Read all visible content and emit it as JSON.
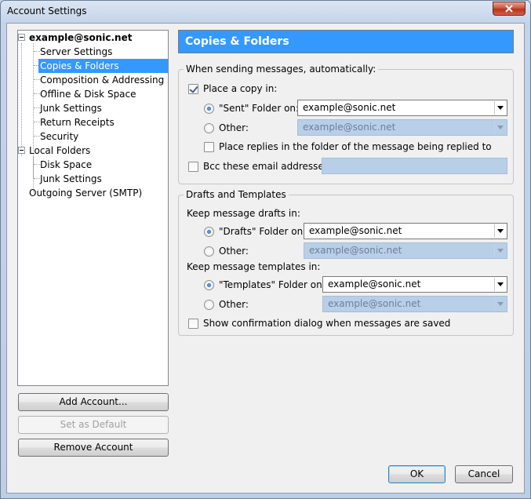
{
  "window": {
    "title": "Account Settings"
  },
  "tree": {
    "items": [
      {
        "label": "example@sonic.net",
        "level": 0,
        "bold": true,
        "expander": true
      },
      {
        "label": "Server Settings",
        "level": 1
      },
      {
        "label": "Copies & Folders",
        "level": 1,
        "selected": true
      },
      {
        "label": "Composition & Addressing",
        "level": 1
      },
      {
        "label": "Offline & Disk Space",
        "level": 1
      },
      {
        "label": "Junk Settings",
        "level": 1
      },
      {
        "label": "Return Receipts",
        "level": 1
      },
      {
        "label": "Security",
        "level": 1
      },
      {
        "label": "Local Folders",
        "level": 0,
        "expander": true
      },
      {
        "label": "Disk Space",
        "level": 1
      },
      {
        "label": "Junk Settings",
        "level": 1
      },
      {
        "label": "Outgoing Server (SMTP)",
        "level": 0
      }
    ]
  },
  "buttons": {
    "add_account": "Add Account...",
    "set_default": "Set as Default",
    "remove_account": "Remove Account",
    "ok": "OK",
    "cancel": "Cancel"
  },
  "panel": {
    "title": "Copies & Folders",
    "sending": {
      "legend": "When sending messages, automatically:",
      "place_copy": {
        "label": "Place a copy in:",
        "checked": true
      },
      "sent_folder": {
        "label": "\"Sent\" Folder on:",
        "value": "example@sonic.net",
        "selected": true
      },
      "other": {
        "label": "Other:",
        "value": "example@sonic.net",
        "selected": false
      },
      "place_replies": {
        "label": "Place replies in the folder of the message being replied to",
        "checked": false
      },
      "bcc": {
        "label": "Bcc these email addresses:",
        "checked": false,
        "value": ""
      }
    },
    "drafts": {
      "legend": "Drafts and Templates",
      "keep_drafts": "Keep message drafts in:",
      "drafts_folder": {
        "label": "\"Drafts\" Folder on:",
        "value": "example@sonic.net",
        "selected": true
      },
      "drafts_other": {
        "label": "Other:",
        "value": "example@sonic.net",
        "selected": false
      },
      "keep_templates": "Keep message templates in:",
      "templates_folder": {
        "label": "\"Templates\" Folder on:",
        "value": "example@sonic.net",
        "selected": true
      },
      "templates_other": {
        "label": "Other:",
        "value": "example@sonic.net",
        "selected": false
      },
      "show_confirmation": {
        "label": "Show confirmation dialog when messages are saved",
        "checked": false
      }
    }
  },
  "colors": {
    "selection": "#3399ff",
    "banner": "#3399ff",
    "disabled_field": "#b8cfe8"
  }
}
